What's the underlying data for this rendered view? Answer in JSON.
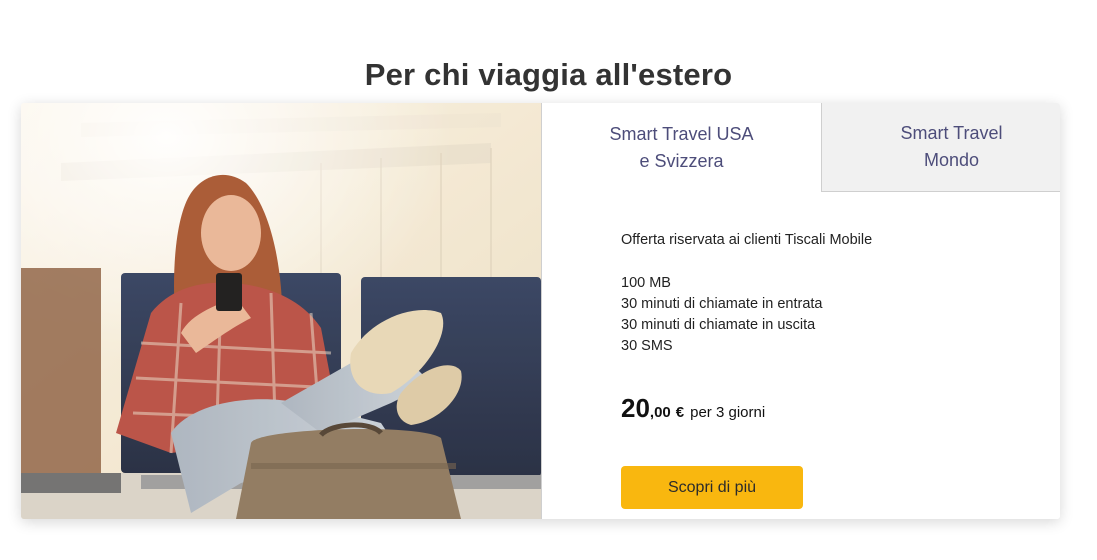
{
  "page": {
    "title": "Per chi viaggia all'estero"
  },
  "tabs": [
    {
      "label": "Smart Travel USA\ne Svizzera",
      "active": true
    },
    {
      "label": "Smart Travel\nMondo",
      "active": false
    }
  ],
  "offer": {
    "intro": "Offerta riservata ai clienti Tiscali Mobile",
    "features": [
      "100 MB",
      "30 minuti di chiamate in entrata",
      "30 minuti di chiamate in uscita",
      "30 SMS"
    ],
    "price": {
      "integer": "20",
      "decimal": ",00",
      "currency": "€",
      "period": "per 3 giorni"
    },
    "cta_label": "Scopri di più"
  },
  "colors": {
    "title": "#333333",
    "tab_text": "#4d4d7a",
    "tab_inactive_bg": "#f1f1f1",
    "cta_bg": "#f9b70f"
  },
  "image": {
    "subject": "woman-traveler-with-phone-at-airport"
  }
}
